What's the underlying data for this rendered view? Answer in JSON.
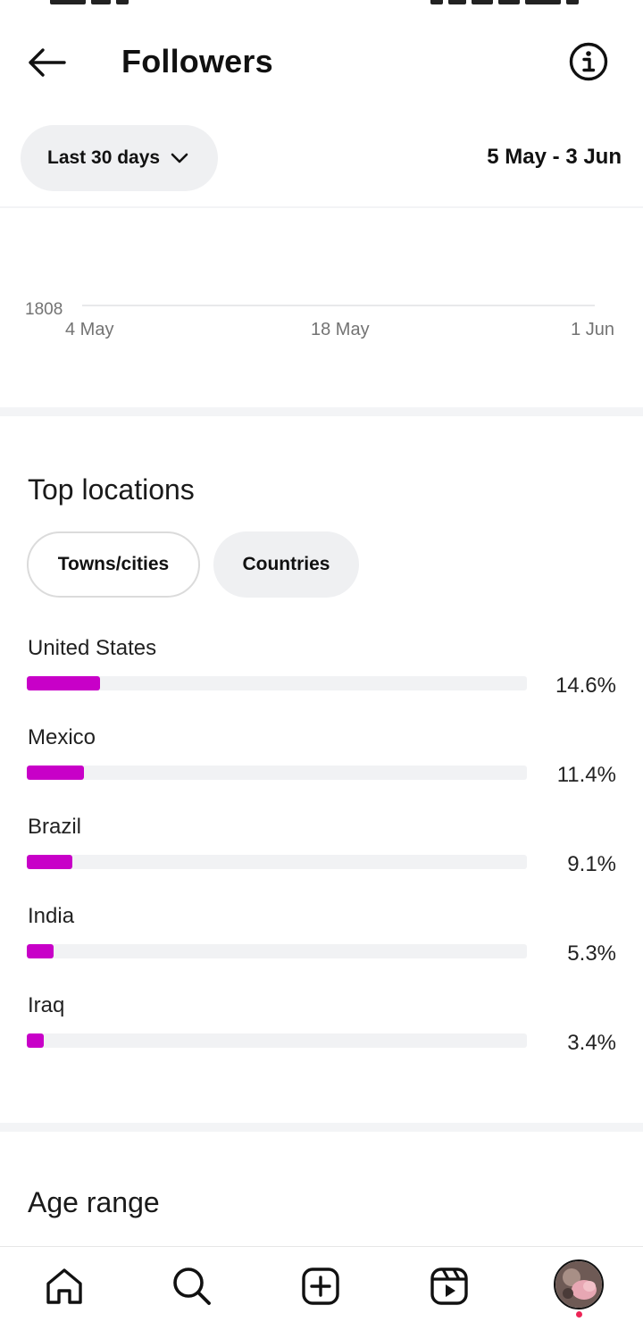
{
  "header": {
    "title": "Followers",
    "back_icon": "arrow-left-icon",
    "info_icon": "info-circle-icon"
  },
  "filter": {
    "range_label": "Last 30 days",
    "chevron_icon": "chevron-down-icon",
    "date_range": "5 May - 3 Jun"
  },
  "chart_data": {
    "type": "line",
    "x_tick_labels": [
      "4 May",
      "18 May",
      "1 Jun"
    ],
    "y_tick_labels": [
      "1808"
    ],
    "series": []
  },
  "top_locations": {
    "title": "Top locations",
    "tabs": [
      {
        "label": "Towns/cities",
        "selected": true
      },
      {
        "label": "Countries",
        "selected": false
      }
    ],
    "bar_color": "#c800c8",
    "items": [
      {
        "name": "United States",
        "percent_label": "14.6%",
        "fill_fraction": 0.146
      },
      {
        "name": "Mexico",
        "percent_label": "11.4%",
        "fill_fraction": 0.114
      },
      {
        "name": "Brazil",
        "percent_label": "9.1%",
        "fill_fraction": 0.091
      },
      {
        "name": "India",
        "percent_label": "5.3%",
        "fill_fraction": 0.053
      },
      {
        "name": "Iraq",
        "percent_label": "3.4%",
        "fill_fraction": 0.034
      }
    ]
  },
  "age_range": {
    "title": "Age range"
  },
  "bottom_nav": {
    "items": [
      "home-icon",
      "search-icon",
      "create-plus-icon",
      "reels-icon",
      "profile-avatar"
    ]
  }
}
